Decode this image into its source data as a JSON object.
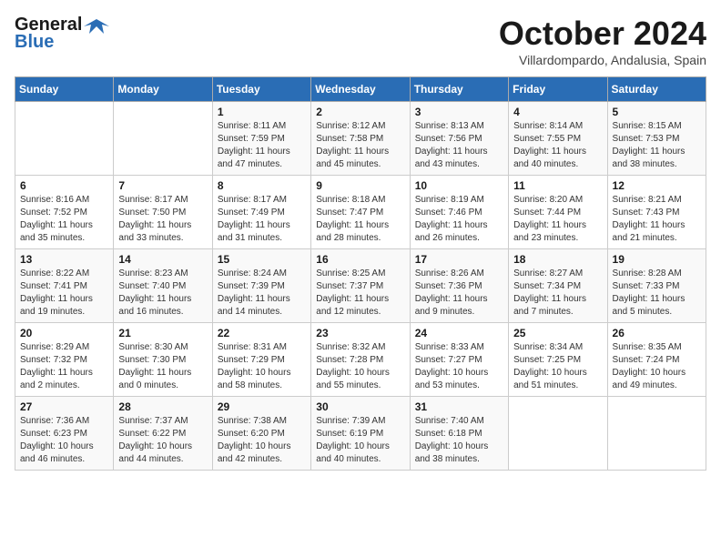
{
  "header": {
    "logo_general": "General",
    "logo_blue": "Blue",
    "month_title": "October 2024",
    "subtitle": "Villardompardo, Andalusia, Spain"
  },
  "weekdays": [
    "Sunday",
    "Monday",
    "Tuesday",
    "Wednesday",
    "Thursday",
    "Friday",
    "Saturday"
  ],
  "weeks": [
    [
      {
        "day": "",
        "detail": ""
      },
      {
        "day": "",
        "detail": ""
      },
      {
        "day": "1",
        "detail": "Sunrise: 8:11 AM\nSunset: 7:59 PM\nDaylight: 11 hours and 47 minutes."
      },
      {
        "day": "2",
        "detail": "Sunrise: 8:12 AM\nSunset: 7:58 PM\nDaylight: 11 hours and 45 minutes."
      },
      {
        "day": "3",
        "detail": "Sunrise: 8:13 AM\nSunset: 7:56 PM\nDaylight: 11 hours and 43 minutes."
      },
      {
        "day": "4",
        "detail": "Sunrise: 8:14 AM\nSunset: 7:55 PM\nDaylight: 11 hours and 40 minutes."
      },
      {
        "day": "5",
        "detail": "Sunrise: 8:15 AM\nSunset: 7:53 PM\nDaylight: 11 hours and 38 minutes."
      }
    ],
    [
      {
        "day": "6",
        "detail": "Sunrise: 8:16 AM\nSunset: 7:52 PM\nDaylight: 11 hours and 35 minutes."
      },
      {
        "day": "7",
        "detail": "Sunrise: 8:17 AM\nSunset: 7:50 PM\nDaylight: 11 hours and 33 minutes."
      },
      {
        "day": "8",
        "detail": "Sunrise: 8:17 AM\nSunset: 7:49 PM\nDaylight: 11 hours and 31 minutes."
      },
      {
        "day": "9",
        "detail": "Sunrise: 8:18 AM\nSunset: 7:47 PM\nDaylight: 11 hours and 28 minutes."
      },
      {
        "day": "10",
        "detail": "Sunrise: 8:19 AM\nSunset: 7:46 PM\nDaylight: 11 hours and 26 minutes."
      },
      {
        "day": "11",
        "detail": "Sunrise: 8:20 AM\nSunset: 7:44 PM\nDaylight: 11 hours and 23 minutes."
      },
      {
        "day": "12",
        "detail": "Sunrise: 8:21 AM\nSunset: 7:43 PM\nDaylight: 11 hours and 21 minutes."
      }
    ],
    [
      {
        "day": "13",
        "detail": "Sunrise: 8:22 AM\nSunset: 7:41 PM\nDaylight: 11 hours and 19 minutes."
      },
      {
        "day": "14",
        "detail": "Sunrise: 8:23 AM\nSunset: 7:40 PM\nDaylight: 11 hours and 16 minutes."
      },
      {
        "day": "15",
        "detail": "Sunrise: 8:24 AM\nSunset: 7:39 PM\nDaylight: 11 hours and 14 minutes."
      },
      {
        "day": "16",
        "detail": "Sunrise: 8:25 AM\nSunset: 7:37 PM\nDaylight: 11 hours and 12 minutes."
      },
      {
        "day": "17",
        "detail": "Sunrise: 8:26 AM\nSunset: 7:36 PM\nDaylight: 11 hours and 9 minutes."
      },
      {
        "day": "18",
        "detail": "Sunrise: 8:27 AM\nSunset: 7:34 PM\nDaylight: 11 hours and 7 minutes."
      },
      {
        "day": "19",
        "detail": "Sunrise: 8:28 AM\nSunset: 7:33 PM\nDaylight: 11 hours and 5 minutes."
      }
    ],
    [
      {
        "day": "20",
        "detail": "Sunrise: 8:29 AM\nSunset: 7:32 PM\nDaylight: 11 hours and 2 minutes."
      },
      {
        "day": "21",
        "detail": "Sunrise: 8:30 AM\nSunset: 7:30 PM\nDaylight: 11 hours and 0 minutes."
      },
      {
        "day": "22",
        "detail": "Sunrise: 8:31 AM\nSunset: 7:29 PM\nDaylight: 10 hours and 58 minutes."
      },
      {
        "day": "23",
        "detail": "Sunrise: 8:32 AM\nSunset: 7:28 PM\nDaylight: 10 hours and 55 minutes."
      },
      {
        "day": "24",
        "detail": "Sunrise: 8:33 AM\nSunset: 7:27 PM\nDaylight: 10 hours and 53 minutes."
      },
      {
        "day": "25",
        "detail": "Sunrise: 8:34 AM\nSunset: 7:25 PM\nDaylight: 10 hours and 51 minutes."
      },
      {
        "day": "26",
        "detail": "Sunrise: 8:35 AM\nSunset: 7:24 PM\nDaylight: 10 hours and 49 minutes."
      }
    ],
    [
      {
        "day": "27",
        "detail": "Sunrise: 7:36 AM\nSunset: 6:23 PM\nDaylight: 10 hours and 46 minutes."
      },
      {
        "day": "28",
        "detail": "Sunrise: 7:37 AM\nSunset: 6:22 PM\nDaylight: 10 hours and 44 minutes."
      },
      {
        "day": "29",
        "detail": "Sunrise: 7:38 AM\nSunset: 6:20 PM\nDaylight: 10 hours and 42 minutes."
      },
      {
        "day": "30",
        "detail": "Sunrise: 7:39 AM\nSunset: 6:19 PM\nDaylight: 10 hours and 40 minutes."
      },
      {
        "day": "31",
        "detail": "Sunrise: 7:40 AM\nSunset: 6:18 PM\nDaylight: 10 hours and 38 minutes."
      },
      {
        "day": "",
        "detail": ""
      },
      {
        "day": "",
        "detail": ""
      }
    ]
  ]
}
